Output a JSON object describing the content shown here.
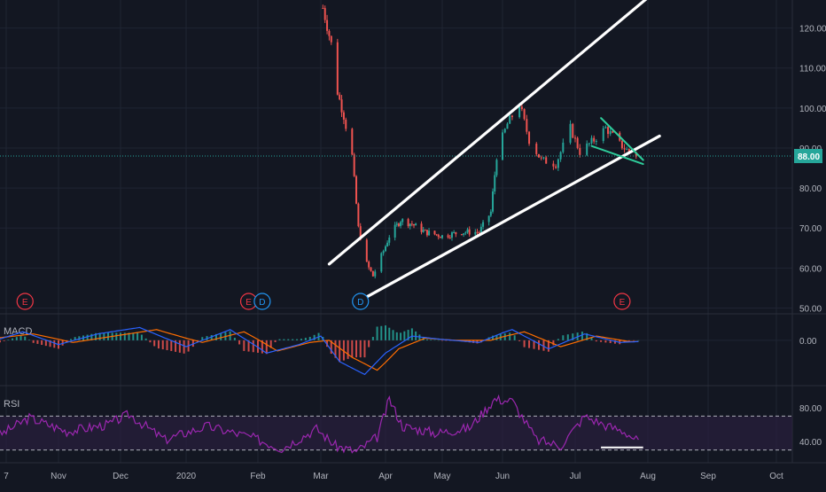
{
  "colors": {
    "background": "#131722",
    "grid": "#1f2433",
    "axis_text": "#b2b5be",
    "candle_up": "#26a69a",
    "candle_down": "#ef5350",
    "trendline": "#ffffff",
    "flag_lines": "#2ecc9a",
    "price_line": "#26a69a",
    "price_badge": "#26a69a",
    "event_red": "#f23645",
    "event_blue": "#2196f3",
    "macd_line": "#2962ff",
    "signal_line": "#ff6d00",
    "rsi_line": "#9c27b0",
    "rsi_band": "#2a1f3d"
  },
  "chart_data": [
    {
      "type": "candlestick",
      "panel": "price",
      "x_ticks": [
        "7",
        "Nov",
        "Dec",
        "2020",
        "Feb",
        "Mar",
        "Apr",
        "May",
        "Jun",
        "Jul",
        "Aug",
        "Sep",
        "Oct"
      ],
      "y_ticks": [
        "50.00",
        "60.00",
        "70.00",
        "80.00",
        "90.00",
        "100.00",
        "110.00",
        "120.00"
      ],
      "ylim": [
        49,
        127
      ],
      "last_price": "88.00",
      "last_price_value": 88,
      "series_close": [
        {
          "date": "2020-03-02",
          "value": 125
        },
        {
          "date": "2020-03-06",
          "value": 116
        },
        {
          "date": "2020-03-09",
          "value": 104
        },
        {
          "date": "2020-03-12",
          "value": 98
        },
        {
          "date": "2020-03-16",
          "value": 88
        },
        {
          "date": "2020-03-19",
          "value": 70
        },
        {
          "date": "2020-03-23",
          "value": 61
        },
        {
          "date": "2020-03-26",
          "value": 58
        },
        {
          "date": "2020-03-30",
          "value": 63
        },
        {
          "date": "2020-04-03",
          "value": 68
        },
        {
          "date": "2020-04-09",
          "value": 72
        },
        {
          "date": "2020-04-15",
          "value": 71
        },
        {
          "date": "2020-04-22",
          "value": 69
        },
        {
          "date": "2020-05-01",
          "value": 68
        },
        {
          "date": "2020-05-11",
          "value": 69
        },
        {
          "date": "2020-05-20",
          "value": 69
        },
        {
          "date": "2020-05-26",
          "value": 74
        },
        {
          "date": "2020-05-29",
          "value": 88
        },
        {
          "date": "2020-06-03",
          "value": 96
        },
        {
          "date": "2020-06-08",
          "value": 101
        },
        {
          "date": "2020-06-12",
          "value": 92
        },
        {
          "date": "2020-06-17",
          "value": 87
        },
        {
          "date": "2020-06-23",
          "value": 86
        },
        {
          "date": "2020-06-29",
          "value": 95
        },
        {
          "date": "2020-07-03",
          "value": 89
        },
        {
          "date": "2020-07-09",
          "value": 92
        },
        {
          "date": "2020-07-14",
          "value": 95
        },
        {
          "date": "2020-07-20",
          "value": 91
        },
        {
          "date": "2020-07-24",
          "value": 89
        },
        {
          "date": "2020-07-28",
          "value": 88
        }
      ],
      "trendlines": [
        {
          "name": "upper-channel",
          "from": {
            "date": "2020-03-05",
            "value": 61
          },
          "to": {
            "date": "2020-08-02",
            "value": 128
          }
        },
        {
          "name": "lower-channel",
          "from": {
            "date": "2020-03-22",
            "value": 52.5
          },
          "to": {
            "date": "2020-08-07",
            "value": 93
          }
        },
        {
          "name": "flag-upper",
          "from": {
            "date": "2020-07-12",
            "value": 97.5
          },
          "to": {
            "date": "2020-07-30",
            "value": 87
          }
        },
        {
          "name": "flag-lower",
          "from": {
            "date": "2020-07-08",
            "value": 90.5
          },
          "to": {
            "date": "2020-07-30",
            "value": 86
          }
        }
      ],
      "events": [
        {
          "label": "E",
          "kind": "earnings",
          "date": "2019-10-16"
        },
        {
          "label": "E",
          "kind": "earnings",
          "date": "2020-01-28"
        },
        {
          "label": "D",
          "kind": "dividend",
          "date": "2020-02-03"
        },
        {
          "label": "D",
          "kind": "dividend",
          "date": "2020-03-20"
        },
        {
          "label": "E",
          "kind": "earnings",
          "date": "2020-07-21"
        }
      ]
    },
    {
      "type": "line",
      "panel": "macd",
      "title": "MACD",
      "y_ticks": [
        "0.00"
      ],
      "ylim": [
        -10,
        6
      ],
      "series": [
        {
          "values_by_date": [
            {
              "date": "2019-10-02",
              "value": 0
            },
            {
              "date": "2019-10-15",
              "value": 2
            },
            {
              "date": "2019-11-01",
              "value": -1
            },
            {
              "date": "2019-11-20",
              "value": 1.5
            },
            {
              "date": "2019-12-10",
              "value": 3
            },
            {
              "date": "2020-01-01",
              "value": -1.5
            },
            {
              "date": "2020-01-20",
              "value": 2.5
            },
            {
              "date": "2020-02-05",
              "value": -3
            },
            {
              "date": "2020-02-20",
              "value": -1
            },
            {
              "date": "2020-03-01",
              "value": 1
            },
            {
              "date": "2020-03-10",
              "value": -5
            },
            {
              "date": "2020-03-22",
              "value": -8
            },
            {
              "date": "2020-04-01",
              "value": -3
            },
            {
              "date": "2020-04-15",
              "value": 1
            },
            {
              "date": "2020-05-01",
              "value": 0.2
            },
            {
              "date": "2020-05-20",
              "value": -0.5
            },
            {
              "date": "2020-06-05",
              "value": 2.5
            },
            {
              "date": "2020-06-20",
              "value": -2
            },
            {
              "date": "2020-07-05",
              "value": 1.5
            },
            {
              "date": "2020-07-20",
              "value": -0.5
            },
            {
              "date": "2020-07-28",
              "value": -0.3
            }
          ]
        },
        {
          "values_by_date": [
            {
              "date": "2019-10-02",
              "value": 0.5
            },
            {
              "date": "2019-10-20",
              "value": 1.5
            },
            {
              "date": "2019-11-08",
              "value": -0.5
            },
            {
              "date": "2019-11-28",
              "value": 1
            },
            {
              "date": "2019-12-18",
              "value": 2.5
            },
            {
              "date": "2020-01-08",
              "value": -0.5
            },
            {
              "date": "2020-01-26",
              "value": 2
            },
            {
              "date": "2020-02-10",
              "value": -2.5
            },
            {
              "date": "2020-02-25",
              "value": -0.5
            },
            {
              "date": "2020-03-05",
              "value": 0
            },
            {
              "date": "2020-03-16",
              "value": -4
            },
            {
              "date": "2020-03-28",
              "value": -7
            },
            {
              "date": "2020-04-08",
              "value": -2
            },
            {
              "date": "2020-04-22",
              "value": 0.5
            },
            {
              "date": "2020-05-08",
              "value": 0
            },
            {
              "date": "2020-05-26",
              "value": 0
            },
            {
              "date": "2020-06-10",
              "value": 2
            },
            {
              "date": "2020-06-25",
              "value": -1.5
            },
            {
              "date": "2020-07-10",
              "value": 1
            },
            {
              "date": "2020-07-24",
              "value": -0.3
            },
            {
              "date": "2020-07-28",
              "value": -0.3
            }
          ]
        }
      ]
    },
    {
      "type": "line",
      "panel": "rsi",
      "title": "RSI",
      "y_ticks": [
        "80.00",
        "40.00"
      ],
      "ylim": [
        17,
        104
      ],
      "bands": [
        70,
        30
      ],
      "series": [
        {
          "values_by_date": [
            {
              "date": "2019-10-02",
              "value": 45
            },
            {
              "date": "2019-10-18",
              "value": 68
            },
            {
              "date": "2019-11-05",
              "value": 52
            },
            {
              "date": "2019-11-25",
              "value": 60
            },
            {
              "date": "2019-12-05",
              "value": 72
            },
            {
              "date": "2019-12-22",
              "value": 42
            },
            {
              "date": "2020-01-10",
              "value": 58
            },
            {
              "date": "2020-01-28",
              "value": 46
            },
            {
              "date": "2020-02-12",
              "value": 32
            },
            {
              "date": "2020-02-28",
              "value": 55
            },
            {
              "date": "2020-03-08",
              "value": 35
            },
            {
              "date": "2020-03-18",
              "value": 28
            },
            {
              "date": "2020-03-28",
              "value": 45
            },
            {
              "date": "2020-04-03",
              "value": 90
            },
            {
              "date": "2020-04-10",
              "value": 58
            },
            {
              "date": "2020-04-28",
              "value": 50
            },
            {
              "date": "2020-05-15",
              "value": 56
            },
            {
              "date": "2020-05-28",
              "value": 90
            },
            {
              "date": "2020-06-05",
              "value": 88
            },
            {
              "date": "2020-06-15",
              "value": 42
            },
            {
              "date": "2020-06-25",
              "value": 35
            },
            {
              "date": "2020-07-05",
              "value": 70
            },
            {
              "date": "2020-07-15",
              "value": 58
            },
            {
              "date": "2020-07-22",
              "value": 52
            },
            {
              "date": "2020-07-28",
              "value": 40
            }
          ]
        }
      ],
      "trendline": {
        "from": {
          "date": "2020-07-12",
          "value": 32
        },
        "to": {
          "date": "2020-07-30",
          "value": 32
        }
      }
    }
  ]
}
